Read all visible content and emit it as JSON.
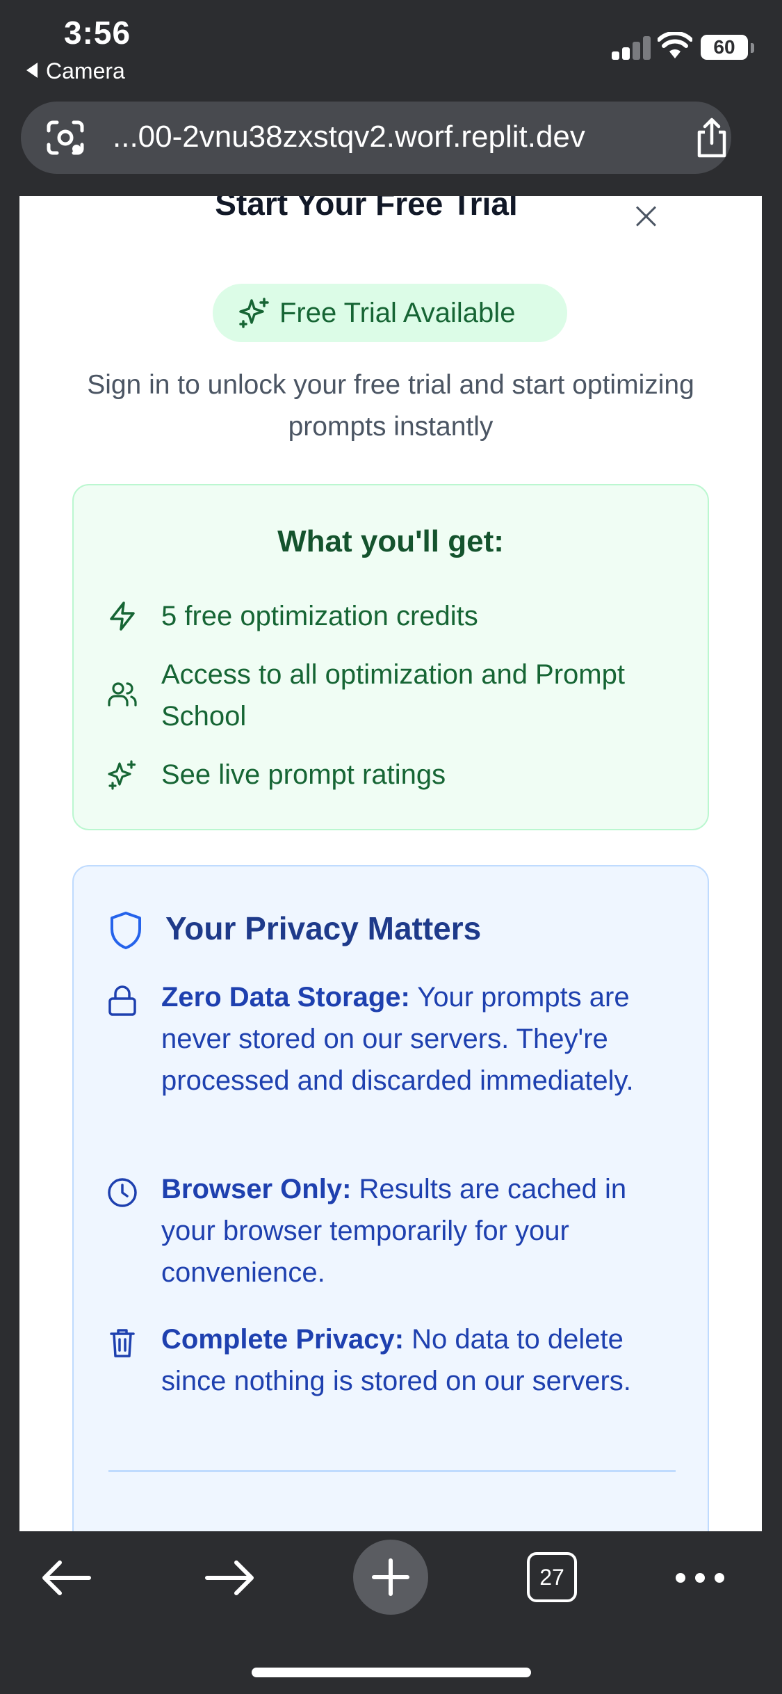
{
  "status_bar": {
    "time": "3:56",
    "back_app": "Camera",
    "battery": "60"
  },
  "url_bar": {
    "url": "...00-2vnu38zxstqv2.worf.replit.dev"
  },
  "modal": {
    "title": "Start Your Free Trial",
    "badge": "Free Trial Available",
    "intro": "Sign in to unlock your free trial and start optimizing prompts instantly",
    "benefits": {
      "title": "What you'll get:",
      "items": [
        {
          "icon": "lightning-icon",
          "text": "5 free optimization credits"
        },
        {
          "icon": "users-icon",
          "text": "Access to all optimization and Prompt School"
        },
        {
          "icon": "sparkles-icon",
          "text": "See live prompt ratings"
        }
      ]
    },
    "privacy": {
      "title": "Your Privacy Matters",
      "items": [
        {
          "icon": "lock-icon",
          "label": "Zero Data Storage:",
          "text": " Your prompts are never stored on our servers. They're processed and discarded immediately."
        },
        {
          "icon": "clock-icon",
          "label": "Browser Only:",
          "text": " Results are cached in your browser temporarily for your convenience."
        },
        {
          "icon": "trash-icon",
          "label": "Complete Privacy:",
          "text": " No data to delete since nothing is stored on our servers."
        }
      ]
    }
  },
  "toolbar": {
    "tab_count": "27"
  },
  "colors": {
    "green_text": "#166534",
    "green_bg": "#f0fdf4",
    "blue_text": "#1e40af",
    "blue_bg": "#eff6ff"
  }
}
